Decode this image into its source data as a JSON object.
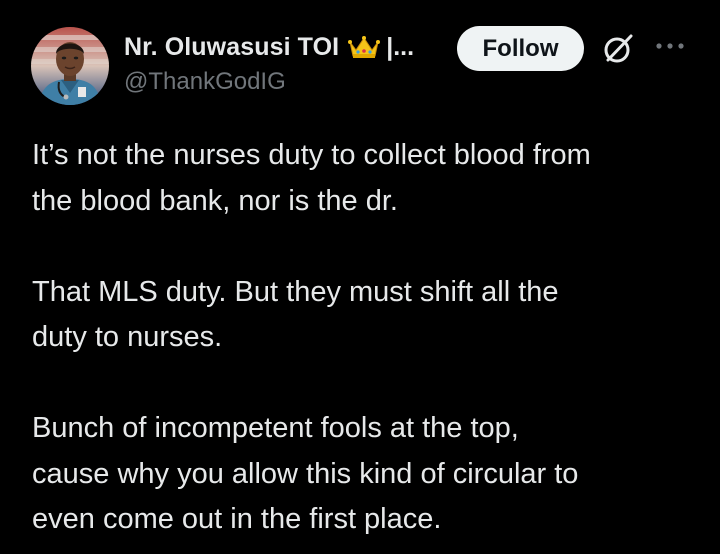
{
  "author": {
    "display_name": "Nr. Oluwasusi TOI",
    "name_suffix": "|...",
    "handle": "@ThankGodIG",
    "avatar_icon": "profile-photo-nurse-in-scrubs",
    "badge_icon": "crown-emoji"
  },
  "actions": {
    "follow_label": "Follow",
    "grok_icon": "grok-icon",
    "more_icon": "more-horizontal-icon"
  },
  "tweet": {
    "paragraphs": [
      "It’s not the nurses duty to collect blood from\nthe blood bank, nor is the dr.",
      "That MLS duty. But they must shift all the\nduty to nurses.",
      "Bunch of incompetent fools at the top,\ncause why you allow this kind of circular to\neven come out in the first place."
    ]
  },
  "colors": {
    "background": "#000000",
    "text_primary": "#e7e9ea",
    "text_secondary": "#71767b",
    "follow_bg": "#eff3f4",
    "follow_text": "#0f1419"
  }
}
